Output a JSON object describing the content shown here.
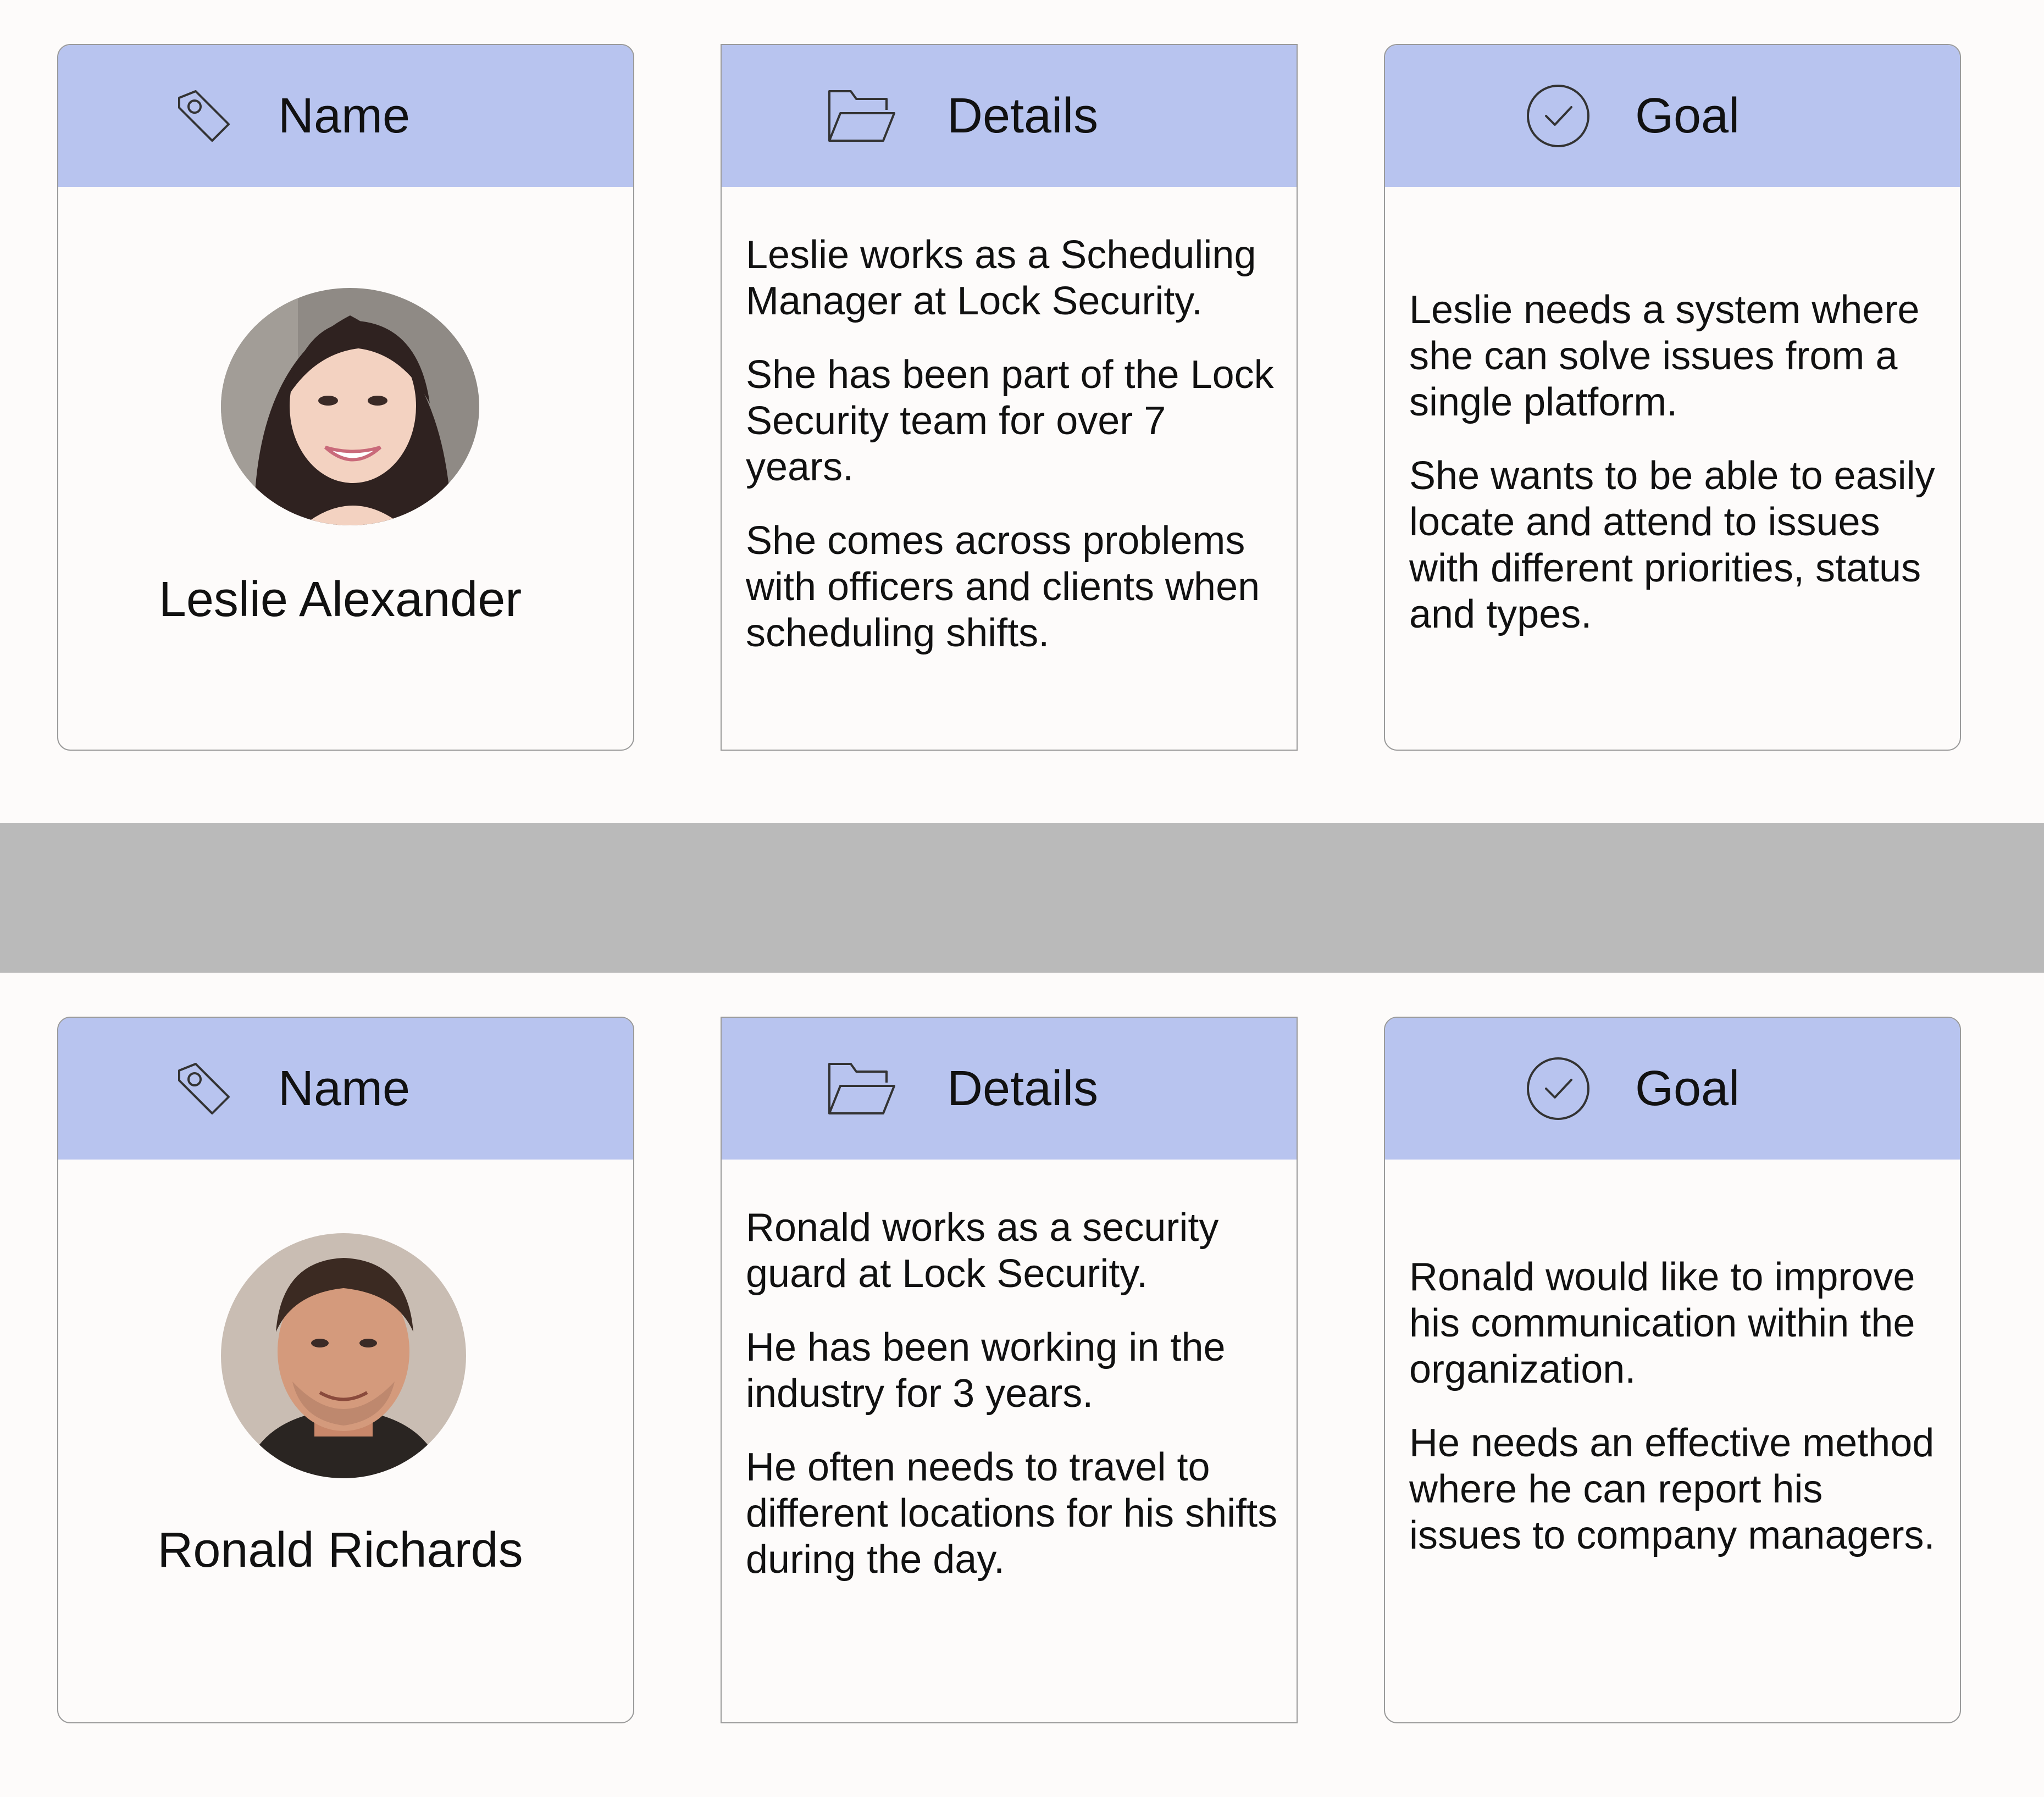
{
  "personas": [
    {
      "name_card": {
        "header_label": "Name",
        "icon": "tag-icon",
        "person_name": "Leslie Alexander",
        "avatar": "female-avatar"
      },
      "details_card": {
        "header_label": "Details",
        "icon": "folder-icon",
        "paragraphs": [
          "Leslie works as a Scheduling Manager at Lock Security.",
          "She has been part of the Lock Security team for over 7 years.",
          "She comes across problems with officers and clients when scheduling shifts."
        ]
      },
      "goal_card": {
        "header_label": "Goal",
        "icon": "check-circle-icon",
        "paragraphs": [
          "Leslie needs a system where she can solve issues from a single platform.",
          "She wants to be able to easily locate and attend to issues with different priorities, status and types."
        ]
      }
    },
    {
      "name_card": {
        "header_label": "Name",
        "icon": "tag-icon",
        "person_name": "Ronald Richards",
        "avatar": "male-avatar"
      },
      "details_card": {
        "header_label": "Details",
        "icon": "folder-icon",
        "paragraphs": [
          "Ronald works as a security guard at Lock Security.",
          "He has been working in the industry for 3 years.",
          "He often needs to travel to different locations for his shifts during the day."
        ]
      },
      "goal_card": {
        "header_label": "Goal",
        "icon": "check-circle-icon",
        "paragraphs": [
          "Ronald would like to improve his communication within the organization.",
          "He needs an effective method where he can report his issues to company managers."
        ]
      }
    }
  ],
  "colors": {
    "header_bg": "#b8c4ef",
    "page_bg": "#fdfbfa",
    "divider": "#bababa",
    "card_border": "#9a9a9a"
  }
}
